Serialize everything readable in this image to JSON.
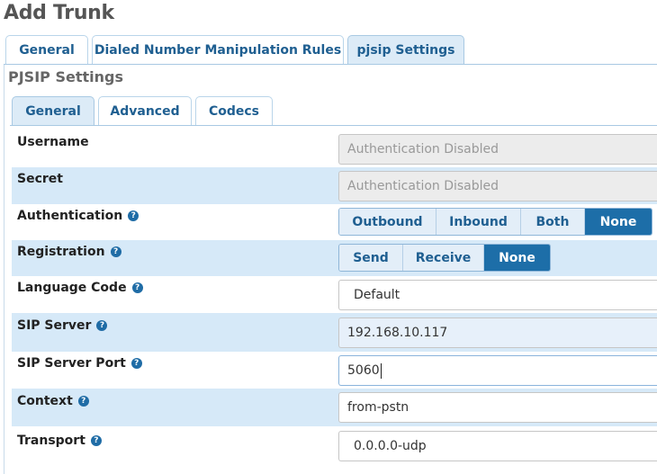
{
  "page": {
    "title": "Add Trunk"
  },
  "top_tabs": [
    {
      "label": "General"
    },
    {
      "label": "Dialed Number Manipulation Rules"
    },
    {
      "label": "pjsip Settings"
    }
  ],
  "panel": {
    "title": "PJSIP Settings"
  },
  "sub_tabs": [
    {
      "label": "General"
    },
    {
      "label": "Advanced"
    },
    {
      "label": "Codecs"
    }
  ],
  "fields": {
    "username": {
      "label": "Username",
      "value": "Authentication Disabled"
    },
    "secret": {
      "label": "Secret",
      "value": "Authentication Disabled"
    },
    "authentication": {
      "label": "Authentication",
      "options": [
        "Outbound",
        "Inbound",
        "Both",
        "None"
      ],
      "selected": "None"
    },
    "registration": {
      "label": "Registration",
      "options": [
        "Send",
        "Receive",
        "None"
      ],
      "selected": "None"
    },
    "language_code": {
      "label": "Language Code",
      "value": "Default"
    },
    "sip_server": {
      "label": "SIP Server",
      "value": "192.168.10.117"
    },
    "sip_server_port": {
      "label": "SIP Server Port",
      "value": "5060"
    },
    "context": {
      "label": "Context",
      "value": "from-pstn"
    },
    "transport": {
      "label": "Transport",
      "value": "0.0.0.0-udp"
    }
  },
  "help_glyph": "?",
  "colors": {
    "accent": "#1d6ea8",
    "row_alt": "#d6e9f8",
    "tab_active": "#dcebf7"
  }
}
